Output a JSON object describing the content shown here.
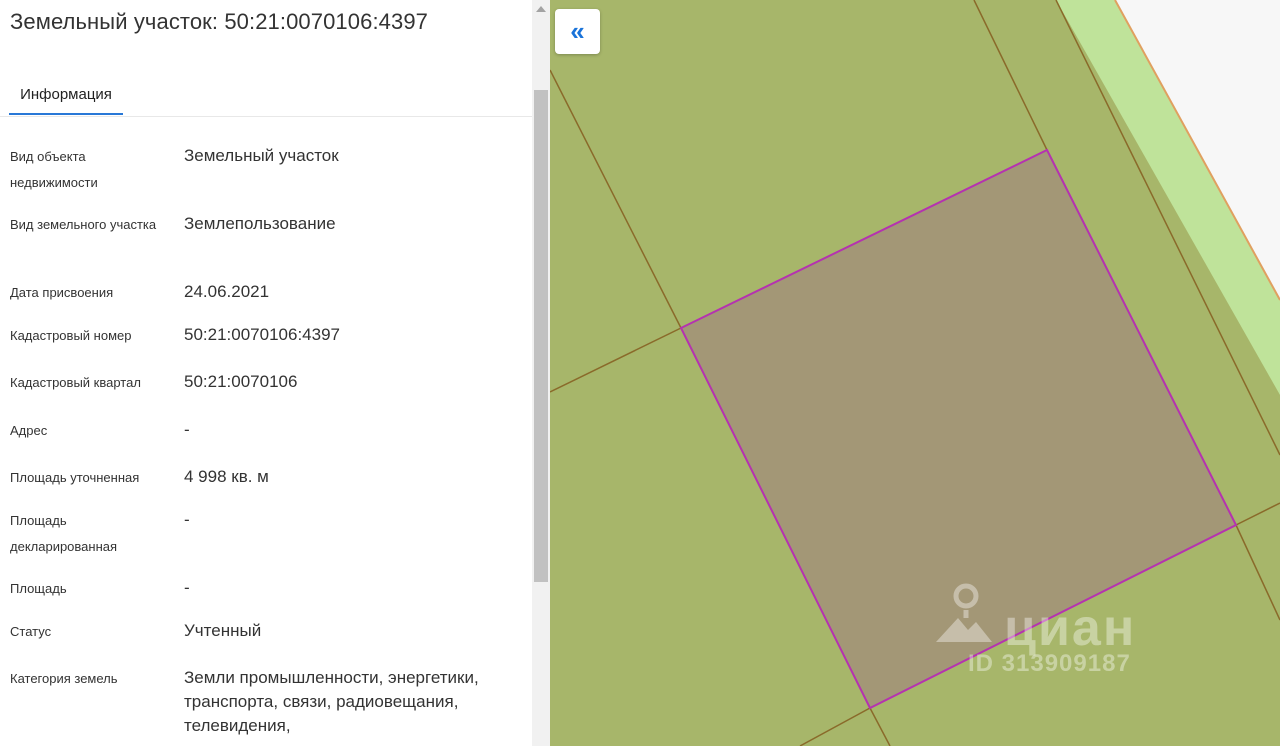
{
  "panel": {
    "title": "Земельный участок: 50:21:0070106:4397",
    "tabs": [
      {
        "label": "Информация",
        "active": true
      }
    ],
    "rows": [
      {
        "label": "Вид объекта недвижимости",
        "value": "Земельный участок"
      },
      {
        "label": "Вид земельного участка",
        "value": "Землепользование"
      },
      {
        "label": "Дата присвоения",
        "value": "24.06.2021"
      },
      {
        "label": "Кадастровый номер",
        "value": "50:21:0070106:4397"
      },
      {
        "label": "Кадастровый квартал",
        "value": "50:21:0070106"
      },
      {
        "label": "Адрес",
        "value": "-"
      },
      {
        "label": "Площадь уточненная",
        "value": "4 998 кв. м"
      },
      {
        "label": "Площадь декларированная",
        "value": "-"
      },
      {
        "label": "Площадь",
        "value": "-"
      },
      {
        "label": "Статус",
        "value": "Учтенный"
      },
      {
        "label": "Категория земель",
        "value": "Земли промышленности, энергетики, транспорта, связи, радиовещания, телевидения,"
      }
    ]
  },
  "map": {
    "collapse_icon": "chevrons-left-icon",
    "collapse_glyph": "«",
    "watermark": {
      "brand": "циан",
      "id": "ID 313909187",
      "icon": "location-pin-icon"
    },
    "colors": {
      "land": "#a7b66a",
      "boundary": "#8a6a2a",
      "selected_fill": "#a39776",
      "selected_border": "#b532b0",
      "road_strip": "#bfe39a",
      "white_area": "#f7f7f7",
      "accent": "#2878d7"
    }
  }
}
